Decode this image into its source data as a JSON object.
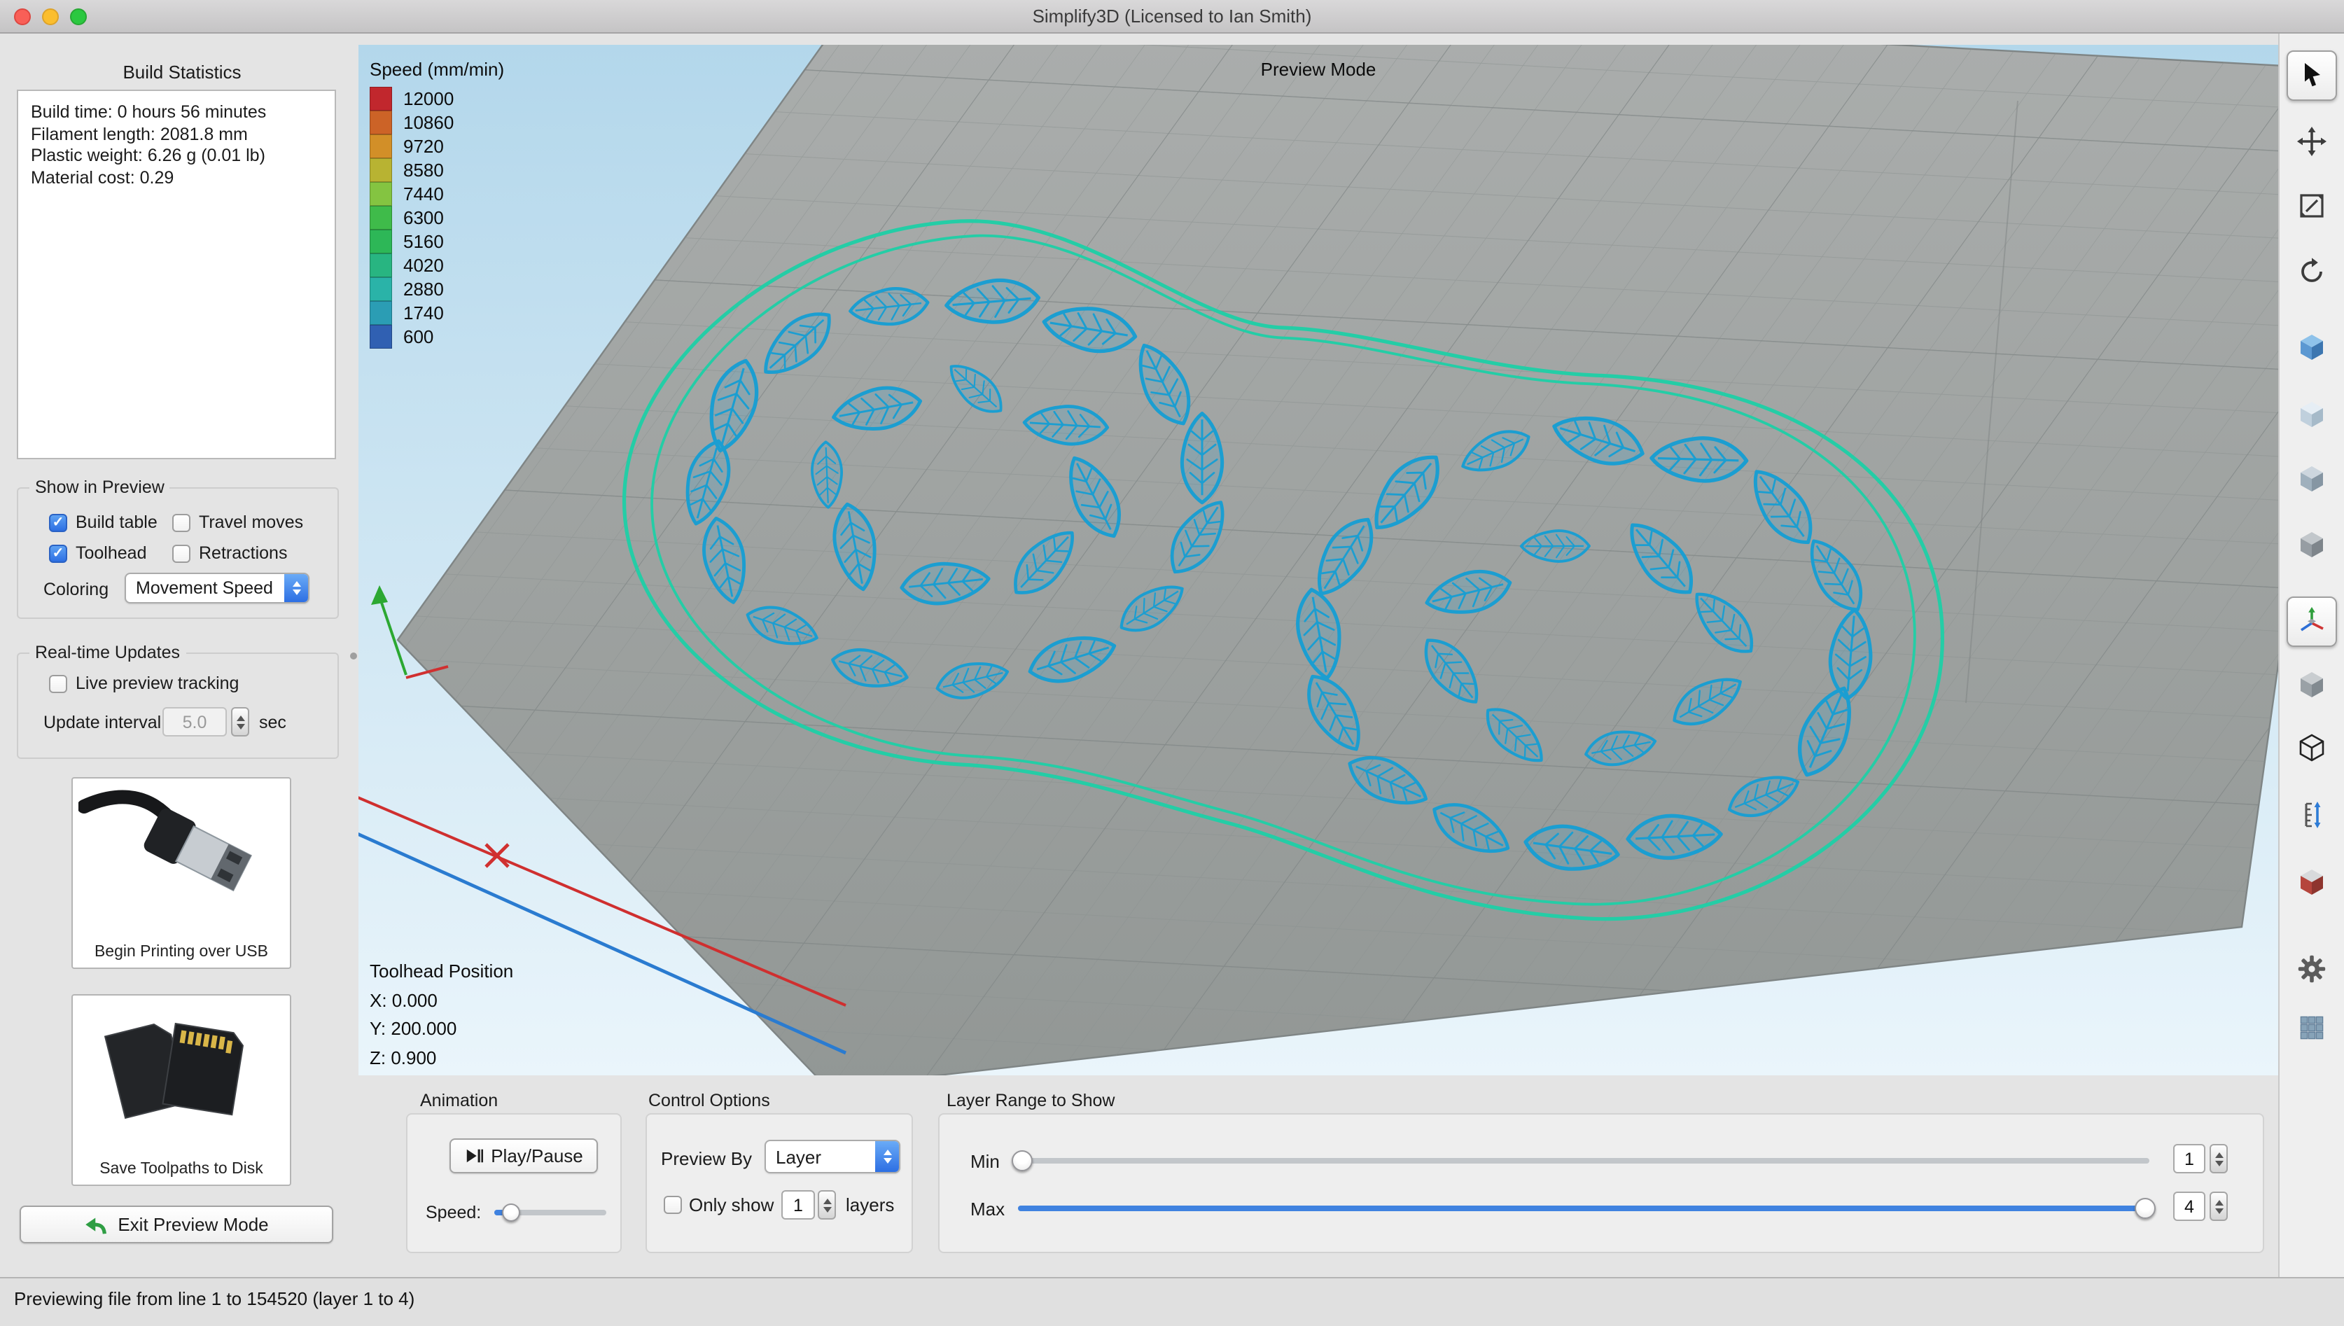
{
  "window": {
    "title": "Simplify3D (Licensed to Ian Smith)"
  },
  "sidebar": {
    "build_statistics": {
      "title": "Build Statistics",
      "lines": [
        "Build time: 0 hours 56 minutes",
        "Filament length: 2081.8 mm",
        "Plastic weight: 6.26 g (0.01 lb)",
        "Material cost: 0.29"
      ]
    },
    "show_in_preview": {
      "title": "Show in Preview",
      "checkboxes": [
        {
          "label": "Build table",
          "checked": true
        },
        {
          "label": "Travel moves",
          "checked": false
        },
        {
          "label": "Toolhead",
          "checked": true
        },
        {
          "label": "Retractions",
          "checked": false
        }
      ],
      "coloring_label": "Coloring",
      "coloring_value": "Movement Speed"
    },
    "realtime_updates": {
      "title": "Real-time Updates",
      "live_preview_label": "Live preview tracking",
      "live_preview_checked": false,
      "update_interval_label": "Update interval",
      "update_interval_value": "5.0",
      "update_interval_unit": "sec"
    },
    "usb_button_label": "Begin Printing over USB",
    "sd_button_label": "Save Toolpaths to Disk",
    "exit_button_label": "Exit Preview Mode"
  },
  "viewport": {
    "mode_label": "Preview Mode",
    "speed_legend": {
      "title": "Speed (mm/min)",
      "entries": [
        {
          "value": "12000",
          "color": "#c1272d"
        },
        {
          "value": "10860",
          "color": "#cc6327"
        },
        {
          "value": "9720",
          "color": "#d28f28"
        },
        {
          "value": "8580",
          "color": "#b8b332"
        },
        {
          "value": "7440",
          "color": "#84c441"
        },
        {
          "value": "6300",
          "color": "#3fbb4a"
        },
        {
          "value": "5160",
          "color": "#2db757"
        },
        {
          "value": "4020",
          "color": "#28b581"
        },
        {
          "value": "2880",
          "color": "#2ab3a8"
        },
        {
          "value": "1740",
          "color": "#2b9db4"
        },
        {
          "value": "600",
          "color": "#3060b2"
        }
      ]
    },
    "toolhead_position": {
      "title": "Toolhead Position",
      "x": "X: 0.000",
      "y": "Y: 200.000",
      "z": "Z: 0.900"
    },
    "colors": {
      "toolpath": "#1b9ed1",
      "outline": "#24cda6",
      "sky_top": "#b3d7eb",
      "sky_bottom": "#eaf5fb",
      "platform_light": "#abaead",
      "platform_dark": "#929795",
      "grid": "#8b9190",
      "grid_major": "#7a8080",
      "accent": "#3f82e0"
    }
  },
  "controls": {
    "animation": {
      "title": "Animation",
      "play_pause_label": "Play/Pause",
      "speed_label": "Speed:",
      "speed_pos": 0.15
    },
    "control_options": {
      "title": "Control Options",
      "preview_by_label": "Preview By",
      "preview_by_value": "Layer",
      "only_show_label": "Only show",
      "only_show_checked": false,
      "only_show_value": "1",
      "layers_label": "layers"
    },
    "layer_range": {
      "title": "Layer Range to Show",
      "min_label": "Min",
      "min_value": "1",
      "min_pos": 0.004,
      "max_label": "Max",
      "max_value": "4",
      "max_pos": 0.996
    }
  },
  "toolbar": {
    "tools": [
      {
        "name": "select",
        "selected": true
      },
      {
        "name": "move",
        "selected": false
      },
      {
        "name": "scale",
        "selected": false
      },
      {
        "name": "rotate",
        "selected": false
      },
      {
        "name": "view-front",
        "selected": false
      },
      {
        "name": "view-top",
        "selected": false
      },
      {
        "name": "view-side",
        "selected": false
      },
      {
        "name": "view-iso",
        "selected": false
      },
      {
        "name": "orient-axes",
        "selected": true
      },
      {
        "name": "cross-section",
        "selected": false
      },
      {
        "name": "wireframe",
        "selected": false
      },
      {
        "name": "measure",
        "selected": false
      },
      {
        "name": "machine",
        "selected": false
      },
      {
        "name": "settings",
        "selected": false
      },
      {
        "name": "toolpaths",
        "selected": false
      }
    ]
  },
  "status_bar": {
    "text": "Previewing file from line 1 to 154520 (layer 1 to 4)"
  }
}
